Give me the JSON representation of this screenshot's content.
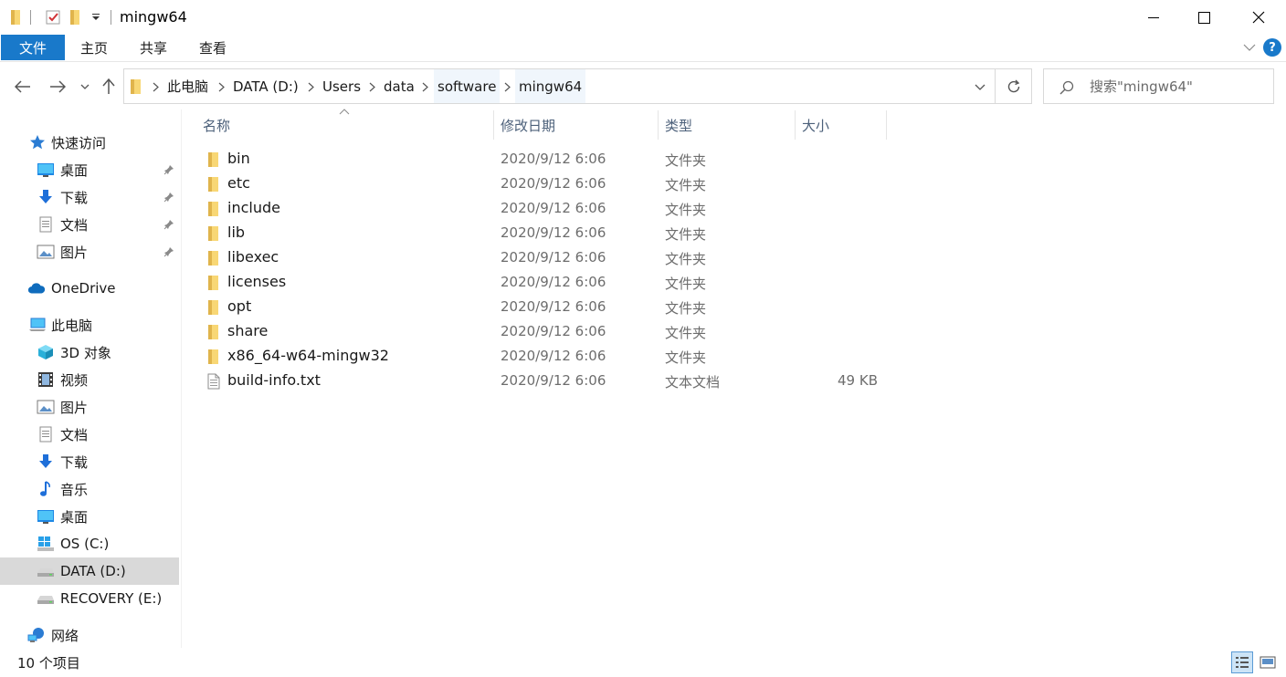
{
  "window": {
    "title": "mingw64",
    "minimize_icon": "minimize-icon",
    "maximize_icon": "maximize-icon",
    "close_icon": "close-icon"
  },
  "quick_access_toolbar": {
    "icons": [
      "folder-icon",
      "properties-check-icon",
      "new-folder-icon",
      "customize-dropdown-icon"
    ]
  },
  "ribbon": {
    "file_tab": "文件",
    "tabs": [
      "主页",
      "共享",
      "查看"
    ],
    "accent_color": "#1979ca"
  },
  "navigation": {
    "back_icon": "back-arrow-icon",
    "forward_icon": "forward-arrow-icon",
    "recent_icon": "chevron-down-icon",
    "up_icon": "up-arrow-icon"
  },
  "address": {
    "crumbs": [
      "此电脑",
      "DATA (D:)",
      "Users",
      "data",
      "software",
      "mingw64"
    ]
  },
  "search": {
    "placeholder": "搜索\"mingw64\""
  },
  "sidebar": {
    "quick_access": "快速访问",
    "pinned": [
      "桌面",
      "下载",
      "文档",
      "图片"
    ],
    "onedrive": "OneDrive",
    "this_pc": "此电脑",
    "pc_items": [
      "3D 对象",
      "视频",
      "图片",
      "文档",
      "下载",
      "音乐",
      "桌面",
      "OS (C:)",
      "DATA (D:)",
      "RECOVERY (E:)"
    ],
    "network": "网络",
    "selected": "DATA (D:)"
  },
  "columns": {
    "name": "名称",
    "date": "修改日期",
    "type": "类型",
    "size": "大小"
  },
  "files": [
    {
      "name": "bin",
      "date": "2020/9/12 6:06",
      "type": "文件夹",
      "size": "",
      "icon": "folder-icon"
    },
    {
      "name": "etc",
      "date": "2020/9/12 6:06",
      "type": "文件夹",
      "size": "",
      "icon": "folder-icon"
    },
    {
      "name": "include",
      "date": "2020/9/12 6:06",
      "type": "文件夹",
      "size": "",
      "icon": "folder-icon"
    },
    {
      "name": "lib",
      "date": "2020/9/12 6:06",
      "type": "文件夹",
      "size": "",
      "icon": "folder-icon"
    },
    {
      "name": "libexec",
      "date": "2020/9/12 6:06",
      "type": "文件夹",
      "size": "",
      "icon": "folder-icon"
    },
    {
      "name": "licenses",
      "date": "2020/9/12 6:06",
      "type": "文件夹",
      "size": "",
      "icon": "folder-icon"
    },
    {
      "name": "opt",
      "date": "2020/9/12 6:06",
      "type": "文件夹",
      "size": "",
      "icon": "folder-icon"
    },
    {
      "name": "share",
      "date": "2020/9/12 6:06",
      "type": "文件夹",
      "size": "",
      "icon": "folder-icon"
    },
    {
      "name": "x86_64-w64-mingw32",
      "date": "2020/9/12 6:06",
      "type": "文件夹",
      "size": "",
      "icon": "folder-icon"
    },
    {
      "name": "build-info.txt",
      "date": "2020/9/12 6:06",
      "type": "文本文档",
      "size": "49 KB",
      "icon": "text-file-icon"
    }
  ],
  "status": {
    "item_count": "10 个项目"
  },
  "colors": {
    "folder": "#f8d775",
    "folder_dark": "#e0b44c",
    "selection": "#d9d9d9",
    "header_text": "#4c607a"
  }
}
